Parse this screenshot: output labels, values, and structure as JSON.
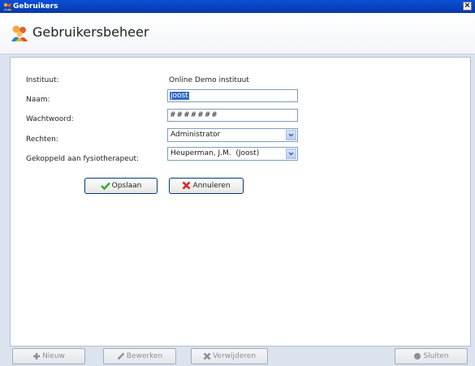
{
  "window": {
    "title": "Gebruikers",
    "close_label": "×"
  },
  "header": {
    "title": "Gebruikersbeheer"
  },
  "form": {
    "instituut_label": "Instituut:",
    "instituut_value": "Online Demo instituut",
    "naam_label": "Naam:",
    "naam_value": "joost",
    "wachtwoord_label": "Wachtwoord:",
    "wachtwoord_value": "#######",
    "rechten_label": "Rechten:",
    "rechten_value": "Administrator",
    "fysio_label": "Gekoppeld aan fysiotherapeut:",
    "fysio_value": "Heuperman, J.M.  (Joost)"
  },
  "actions": {
    "save_label": "Opslaan",
    "cancel_label": "Annuleren"
  },
  "toolbar": {
    "new_label": "Nieuw",
    "edit_label": "Bewerken",
    "delete_label": "Verwijderen",
    "close_label": "Sluiten"
  },
  "colors": {
    "titlebar": "#0a4fd6",
    "background": "#dbe3ee",
    "selection": "#316ac5",
    "save_icon": "#3aa53a",
    "cancel_icon": "#e02020"
  },
  "icons": {
    "window": "users-icon",
    "header": "users-icon",
    "save": "check-icon",
    "cancel": "cross-icon",
    "new": "plus-icon",
    "edit": "pencil-icon",
    "delete": "cross-icon",
    "close": "circle-icon"
  }
}
